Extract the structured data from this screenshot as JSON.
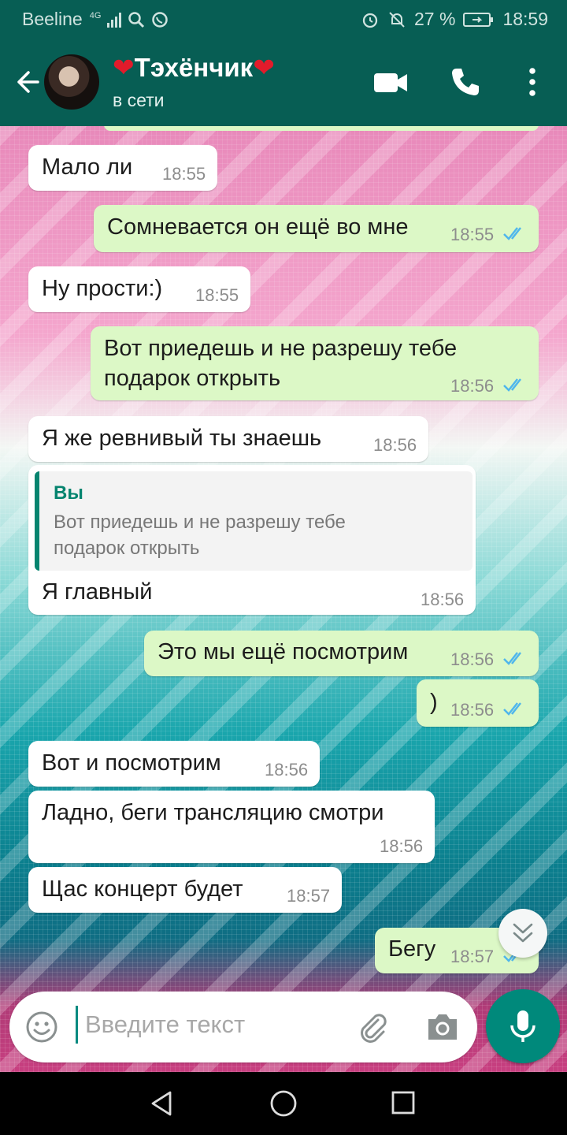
{
  "status_bar": {
    "carrier": "Beeline",
    "network": "4G",
    "battery": "27 %",
    "time": "18:59"
  },
  "header": {
    "contact_name": "Тэхёнчик",
    "heart_left": "❤",
    "heart_right": "❤",
    "status": "в сети"
  },
  "messages": [
    {
      "dir": "in",
      "text": "Мало ли",
      "time": "18:55"
    },
    {
      "dir": "out",
      "text": "Сомневается он ещё во мне",
      "time": "18:55"
    },
    {
      "dir": "in",
      "text": "Ну прости:)",
      "time": "18:55"
    },
    {
      "dir": "out",
      "line1": "Вот приедешь и не разрешу тебе",
      "line2": "подарок открыть",
      "time": "18:56"
    },
    {
      "dir": "in",
      "text": "Я же ревнивый ты знаешь",
      "time": "18:56"
    },
    {
      "dir": "in",
      "quote_author": "Вы",
      "quote_line1": "Вот приедешь и не разрешу тебе",
      "quote_line2": "подарок открыть",
      "text": "Я главный",
      "time": "18:56"
    },
    {
      "dir": "out",
      "text": "Это мы ещё посмотрим",
      "time": "18:56"
    },
    {
      "dir": "out",
      "text": ")",
      "time": "18:56"
    },
    {
      "dir": "in",
      "text": "Вот и посмотрим",
      "time": "18:56"
    },
    {
      "dir": "in",
      "text": "Ладно, беги трансляцию смотри",
      "time": "18:56"
    },
    {
      "dir": "in",
      "text": "Щас концерт будет",
      "time": "18:57"
    },
    {
      "dir": "out",
      "text": "Бегу",
      "time": "18:57"
    }
  ],
  "input": {
    "placeholder": "Введите текст"
  },
  "colors": {
    "header": "#075e54",
    "outgoing": "#dcf8c6",
    "incoming": "#ffffff",
    "accent": "#00897b",
    "ticks": "#4fb6ec"
  },
  "icons": [
    "back-arrow-icon",
    "video-call-icon",
    "phone-icon",
    "more-vert-icon",
    "emoji-icon",
    "attach-icon",
    "camera-icon",
    "mic-icon",
    "scroll-down-icon",
    "nav-back-icon",
    "nav-home-icon",
    "nav-recents-icon"
  ]
}
